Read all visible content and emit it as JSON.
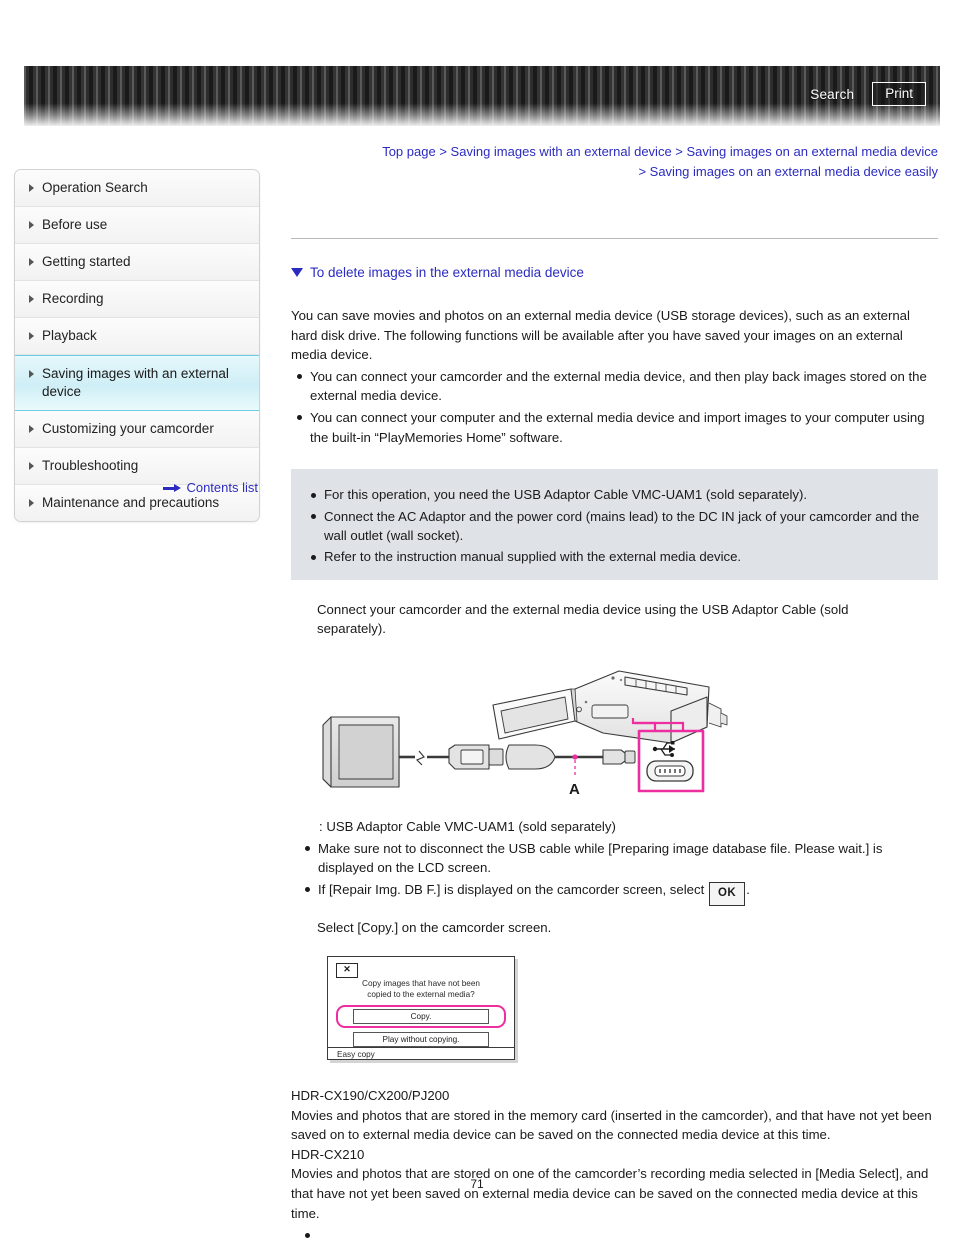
{
  "header": {
    "search_label": "Search",
    "print_label": "Print"
  },
  "breadcrumb": {
    "separator": ">",
    "items": [
      "Top page",
      "Saving images with an external device",
      "Saving images on an external media device",
      "Saving images on an external media device easily"
    ]
  },
  "sidebar": {
    "items": [
      {
        "label": "Operation Search",
        "active": false
      },
      {
        "label": "Before use",
        "active": false
      },
      {
        "label": "Getting started",
        "active": false
      },
      {
        "label": "Recording",
        "active": false
      },
      {
        "label": "Playback",
        "active": false
      },
      {
        "label": "Saving images with an external device",
        "active": true
      },
      {
        "label": "Customizing your camcorder",
        "active": false
      },
      {
        "label": "Troubleshooting",
        "active": false
      },
      {
        "label": "Maintenance and precautions",
        "active": false
      }
    ],
    "contents_list_label": "Contents list"
  },
  "main": {
    "section_heading": "To delete images in the external media device",
    "intro_paragraph": "You can save movies and photos on an external media device (USB storage devices), such as an external hard disk drive. The following functions will be available after you have saved your images on an external media device.",
    "intro_bullets": [
      "You can connect your camcorder and the external media device, and then play back images stored on the external media device.",
      "You can connect your computer and the external media device and import images to your computer using the built-in “PlayMemories Home” software."
    ],
    "note_bullets": [
      "For this operation, you need the USB Adaptor Cable VMC-UAM1 (sold separately).",
      "Connect the AC Adaptor and the power cord (mains lead) to the DC IN jack of your camcorder and the wall outlet (wall socket).",
      "Refer to the instruction manual supplied with the external media device."
    ],
    "connect_paragraph": "Connect your camcorder and the external media device using the USB Adaptor Cable (sold separately).",
    "diagram": {
      "callout_letter": "A",
      "usb_symbol": "USB"
    },
    "cable_caption": ": USB Adaptor Cable VMC-UAM1 (sold separately)",
    "post_diagram_bullets": [
      "Make sure not to disconnect the USB cable while [Preparing image database file. Please wait.] is displayed on the LCD screen."
    ],
    "repair_bullet_before": "If [Repair Img. DB F.] is displayed on the camcorder screen, select",
    "repair_bullet_after": ".",
    "ok_chip_label": "OK",
    "select_copy_line": "Select [Copy.] on the camcorder screen.",
    "camcorder_screen": {
      "close_label": "✕",
      "question_line1": "Copy images that have not been",
      "question_line2": "copied to the external media?",
      "option_copy": "Copy.",
      "option_play": "Play without copying.",
      "footer_label": "Easy copy"
    },
    "model_notes": [
      {
        "model": "HDR-CX190/CX200/PJ200",
        "text": "Movies and photos that are stored in the memory card (inserted in the camcorder), and that have not yet been saved on to external media device can be saved on the connected media device at this time."
      },
      {
        "model": "HDR-CX210",
        "text": "Movies and photos that are stored on one of the camcorder’s recording media selected in [Media Select], and that have not yet been saved on external media device can be saved on the connected media device at this time."
      }
    ],
    "trailing_bullets": [
      ""
    ]
  },
  "page_number": "71",
  "colors": {
    "link": "#2b2bc0",
    "highlight": "#cfeef6",
    "note_bg": "#dfe2e6",
    "callout": "#ec2ea0"
  }
}
